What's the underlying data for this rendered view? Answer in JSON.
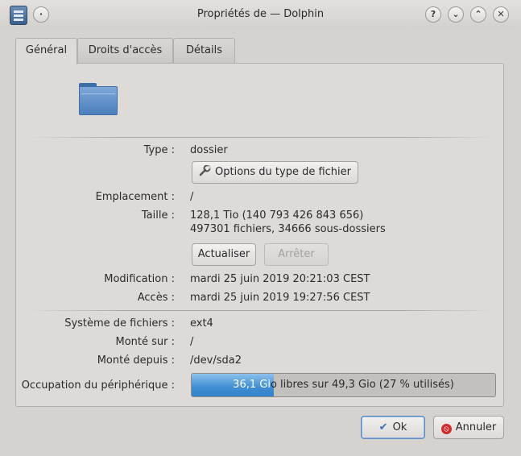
{
  "window": {
    "title": "Propriétés de — Dolphin",
    "buttons": {
      "help": "?",
      "minimize": "⌄",
      "maximize": "⌃",
      "close": "✕"
    }
  },
  "tabs": [
    {
      "label": "Général",
      "active": true
    },
    {
      "label": "Droits d'accès",
      "active": false
    },
    {
      "label": "Détails",
      "active": false
    }
  ],
  "general": {
    "type_label": "Type :",
    "type_value": "dossier",
    "file_type_options_button": "Options du type de fichier",
    "location_label": "Emplacement :",
    "location_value": "/",
    "size_label": "Taille :",
    "size_value": "128,1 Tio (140 793 426 843 656)",
    "size_detail": "497301 fichiers, 34666 sous-dossiers",
    "refresh_button": "Actualiser",
    "stop_button": "Arrêter",
    "modified_label": "Modification :",
    "modified_value": "mardi 25 juin 2019 20:21:03 CEST",
    "accessed_label": "Accès :",
    "accessed_value": "mardi 25 juin 2019 19:27:56 CEST",
    "filesystem_label": "Système de fichiers :",
    "filesystem_value": "ext4",
    "mounted_on_label": "Monté sur :",
    "mounted_on_value": "/",
    "mounted_from_label": "Monté depuis :",
    "mounted_from_value": "/dev/sda2",
    "usage_label": "Occupation du périphérique :",
    "usage_text_highlight": "36,1 Gi",
    "usage_text_rest": "o libres sur 49,3 Gio (27 % utilisés)",
    "usage_percent": 27
  },
  "footer": {
    "ok_button": "Ok",
    "cancel_button": "Annuler"
  },
  "icons": {
    "app": "dolphin-properties-icon",
    "folder": "folder-icon",
    "file_type": "wrench-icon",
    "ok": "check-icon",
    "cancel": "cancel-icon"
  }
}
